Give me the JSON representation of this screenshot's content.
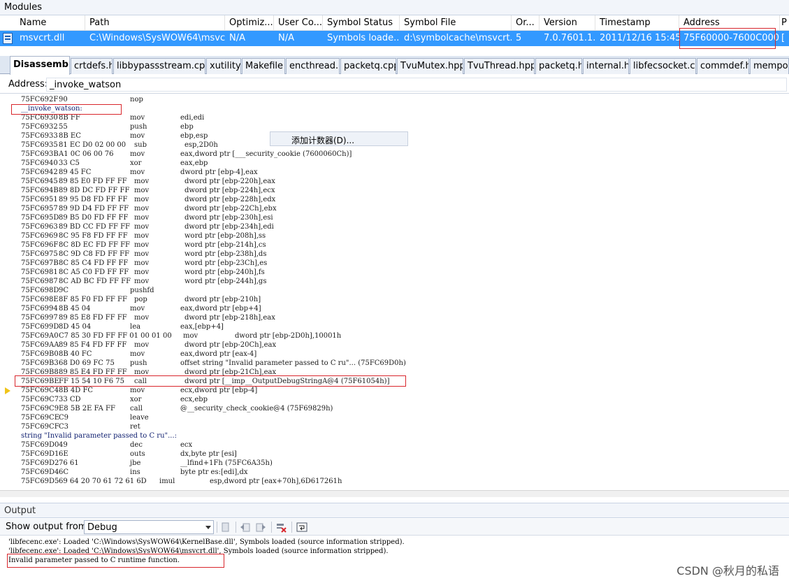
{
  "modules": {
    "title": "Modules",
    "columns": [
      "Name",
      "Path",
      "Optimiz...",
      "User Co...",
      "Symbol Status",
      "Symbol File",
      "Or...",
      "Version",
      "Timestamp",
      "Address",
      "P"
    ],
    "row": {
      "name": "msvcrt.dll",
      "path": "C:\\Windows\\SysWOW64\\msvc...",
      "optimized": "N/A",
      "user_code": "N/A",
      "symbol_status": "Symbols loade...",
      "symbol_file": "d:\\symbolcache\\msvcrt....",
      "order": "5",
      "version": "7.0.7601.1...",
      "timestamp": "2011/12/16 15:45",
      "address": "75F60000-7600C000",
      "extra": "["
    }
  },
  "tabs": [
    "Disassembly",
    "crtdefs.h",
    "libbypassstream.cpp",
    "xutility",
    "Makefile",
    "encthread.h",
    "packetq.cpp",
    "TvuMutex.hpp",
    "TvuThread.hpp",
    "packetq.h",
    "internal.h",
    "libfecsocket.cc",
    "commdef.h",
    "mempo"
  ],
  "address_bar": {
    "label": "Address:",
    "value": "_invoke_watson"
  },
  "context_menu_item": "添加计数器(D)...",
  "disassembly": [
    {
      "addr": "75FC692F",
      "bytes": "90",
      "mn": "nop",
      "op": ""
    },
    {
      "label": "__invoke_watson:"
    },
    {
      "addr": "75FC6930",
      "bytes": "8B FF",
      "mn": "mov",
      "op": "edi,edi"
    },
    {
      "addr": "75FC6932",
      "bytes": "55",
      "mn": "push",
      "op": "ebp"
    },
    {
      "addr": "75FC6933",
      "bytes": "8B EC",
      "mn": "mov",
      "op": "ebp,esp"
    },
    {
      "addr": "75FC6935",
      "bytes": "81 EC D0 02 00 00",
      "mn": "sub",
      "op": "esp,2D0h"
    },
    {
      "addr": "75FC693B",
      "bytes": "A1 0C 06 00 76",
      "mn": "mov",
      "op": "eax,dword ptr [___security_cookie (7600060Ch)]"
    },
    {
      "addr": "75FC6940",
      "bytes": "33 C5",
      "mn": "xor",
      "op": "eax,ebp"
    },
    {
      "addr": "75FC6942",
      "bytes": "89 45 FC",
      "mn": "mov",
      "op": "dword ptr [ebp-4],eax"
    },
    {
      "addr": "75FC6945",
      "bytes": "89 85 E0 FD FF FF",
      "mn": "mov",
      "op": "dword ptr [ebp-220h],eax"
    },
    {
      "addr": "75FC694B",
      "bytes": "89 8D DC FD FF FF",
      "mn": "mov",
      "op": "dword ptr [ebp-224h],ecx"
    },
    {
      "addr": "75FC6951",
      "bytes": "89 95 D8 FD FF FF",
      "mn": "mov",
      "op": "dword ptr [ebp-228h],edx"
    },
    {
      "addr": "75FC6957",
      "bytes": "89 9D D4 FD FF FF",
      "mn": "mov",
      "op": "dword ptr [ebp-22Ch],ebx"
    },
    {
      "addr": "75FC695D",
      "bytes": "89 B5 D0 FD FF FF",
      "mn": "mov",
      "op": "dword ptr [ebp-230h],esi"
    },
    {
      "addr": "75FC6963",
      "bytes": "89 BD CC FD FF FF",
      "mn": "mov",
      "op": "dword ptr [ebp-234h],edi"
    },
    {
      "addr": "75FC6969",
      "bytes": "8C 95 F8 FD FF FF",
      "mn": "mov",
      "op": "word ptr [ebp-208h],ss"
    },
    {
      "addr": "75FC696F",
      "bytes": "8C 8D EC FD FF FF",
      "mn": "mov",
      "op": "word ptr [ebp-214h],cs"
    },
    {
      "addr": "75FC6975",
      "bytes": "8C 9D C8 FD FF FF",
      "mn": "mov",
      "op": "word ptr [ebp-238h],ds"
    },
    {
      "addr": "75FC697B",
      "bytes": "8C 85 C4 FD FF FF",
      "mn": "mov",
      "op": "word ptr [ebp-23Ch],es"
    },
    {
      "addr": "75FC6981",
      "bytes": "8C A5 C0 FD FF FF",
      "mn": "mov",
      "op": "word ptr [ebp-240h],fs"
    },
    {
      "addr": "75FC6987",
      "bytes": "8C AD BC FD FF FF",
      "mn": "mov",
      "op": "word ptr [ebp-244h],gs"
    },
    {
      "addr": "75FC698D",
      "bytes": "9C",
      "mn": "pushfd",
      "op": ""
    },
    {
      "addr": "75FC698E",
      "bytes": "8F 85 F0 FD FF FF",
      "mn": "pop",
      "op": "dword ptr [ebp-210h]"
    },
    {
      "addr": "75FC6994",
      "bytes": "8B 45 04",
      "mn": "mov",
      "op": "eax,dword ptr [ebp+4]"
    },
    {
      "addr": "75FC6997",
      "bytes": "89 85 E8 FD FF FF",
      "mn": "mov",
      "op": "dword ptr [ebp-218h],eax"
    },
    {
      "addr": "75FC699D",
      "bytes": "8D 45 04",
      "mn": "lea",
      "op": "eax,[ebp+4]"
    },
    {
      "addr": "75FC69A0",
      "bytes": "C7 85 30 FD FF FF 01 00 01 00",
      "mn": "mov",
      "op": "dword ptr [ebp-2D0h],10001h"
    },
    {
      "addr": "75FC69AA",
      "bytes": "89 85 F4 FD FF FF",
      "mn": "mov",
      "op": "dword ptr [ebp-20Ch],eax"
    },
    {
      "addr": "75FC69B0",
      "bytes": "8B 40 FC",
      "mn": "mov",
      "op": "eax,dword ptr [eax-4]"
    },
    {
      "addr": "75FC69B3",
      "bytes": "68 D0 69 FC 75",
      "mn": "push",
      "op": "offset string \"Invalid parameter passed to C ru\"... (75FC69D0h)"
    },
    {
      "addr": "75FC69B8",
      "bytes": "89 85 E4 FD FF FF",
      "mn": "mov",
      "op": "dword ptr [ebp-21Ch],eax"
    },
    {
      "addr": "75FC69BE",
      "bytes": "FF 15 54 10 F6 75",
      "mn": "call",
      "op": "dword ptr [__imp__OutputDebugStringA@4 (75F61054h)]"
    },
    {
      "addr": "75FC69C4",
      "bytes": "8B 4D FC",
      "mn": "mov",
      "op": "ecx,dword ptr [ebp-4]"
    },
    {
      "addr": "75FC69C7",
      "bytes": "33 CD",
      "mn": "xor",
      "op": "ecx,ebp"
    },
    {
      "addr": "75FC69C9",
      "bytes": "E8 5B 2E FA FF",
      "mn": "call",
      "op": "@__security_check_cookie@4 (75F69829h)"
    },
    {
      "addr": "75FC69CE",
      "bytes": "C9",
      "mn": "leave",
      "op": ""
    },
    {
      "addr": "75FC69CF",
      "bytes": "C3",
      "mn": "ret",
      "op": ""
    },
    {
      "label": "string \"Invalid parameter passed to C ru\"...:"
    },
    {
      "addr": "75FC69D0",
      "bytes": "49",
      "mn": "dec",
      "op": "ecx"
    },
    {
      "addr": "75FC69D1",
      "bytes": "6E",
      "mn": "outs",
      "op": "dx,byte ptr [esi]"
    },
    {
      "addr": "75FC69D2",
      "bytes": "76 61",
      "mn": "jbe",
      "op": "__lfind+1Fh (75FC6A35h)"
    },
    {
      "addr": "75FC69D4",
      "bytes": "6C",
      "mn": "ins",
      "op": "byte ptr es:[edi],dx"
    },
    {
      "addr": "75FC69D5",
      "bytes": "69 64 20 70 61 72 61 6D",
      "mn": "imul",
      "op": "esp,dword ptr [eax+70h],6D617261h"
    }
  ],
  "output": {
    "title": "Output",
    "show_from_label": "Show output from:",
    "show_from_value": "Debug",
    "lines": [
      "'libfecenc.exe': Loaded 'C:\\Windows\\SysWOW64\\KernelBase.dll', Symbols loaded (source information stripped).",
      "'libfecenc.exe': Loaded 'C:\\Windows\\SysWOW64\\msvcrt.dll', Symbols loaded (source information stripped).",
      "Invalid parameter passed to C runtime function."
    ]
  },
  "watermark": "CSDN @秋月的私语",
  "colors": {
    "selection": "#3399ff",
    "highlight_box": "#d9262c",
    "current_line_arrow": "#f0c419"
  }
}
